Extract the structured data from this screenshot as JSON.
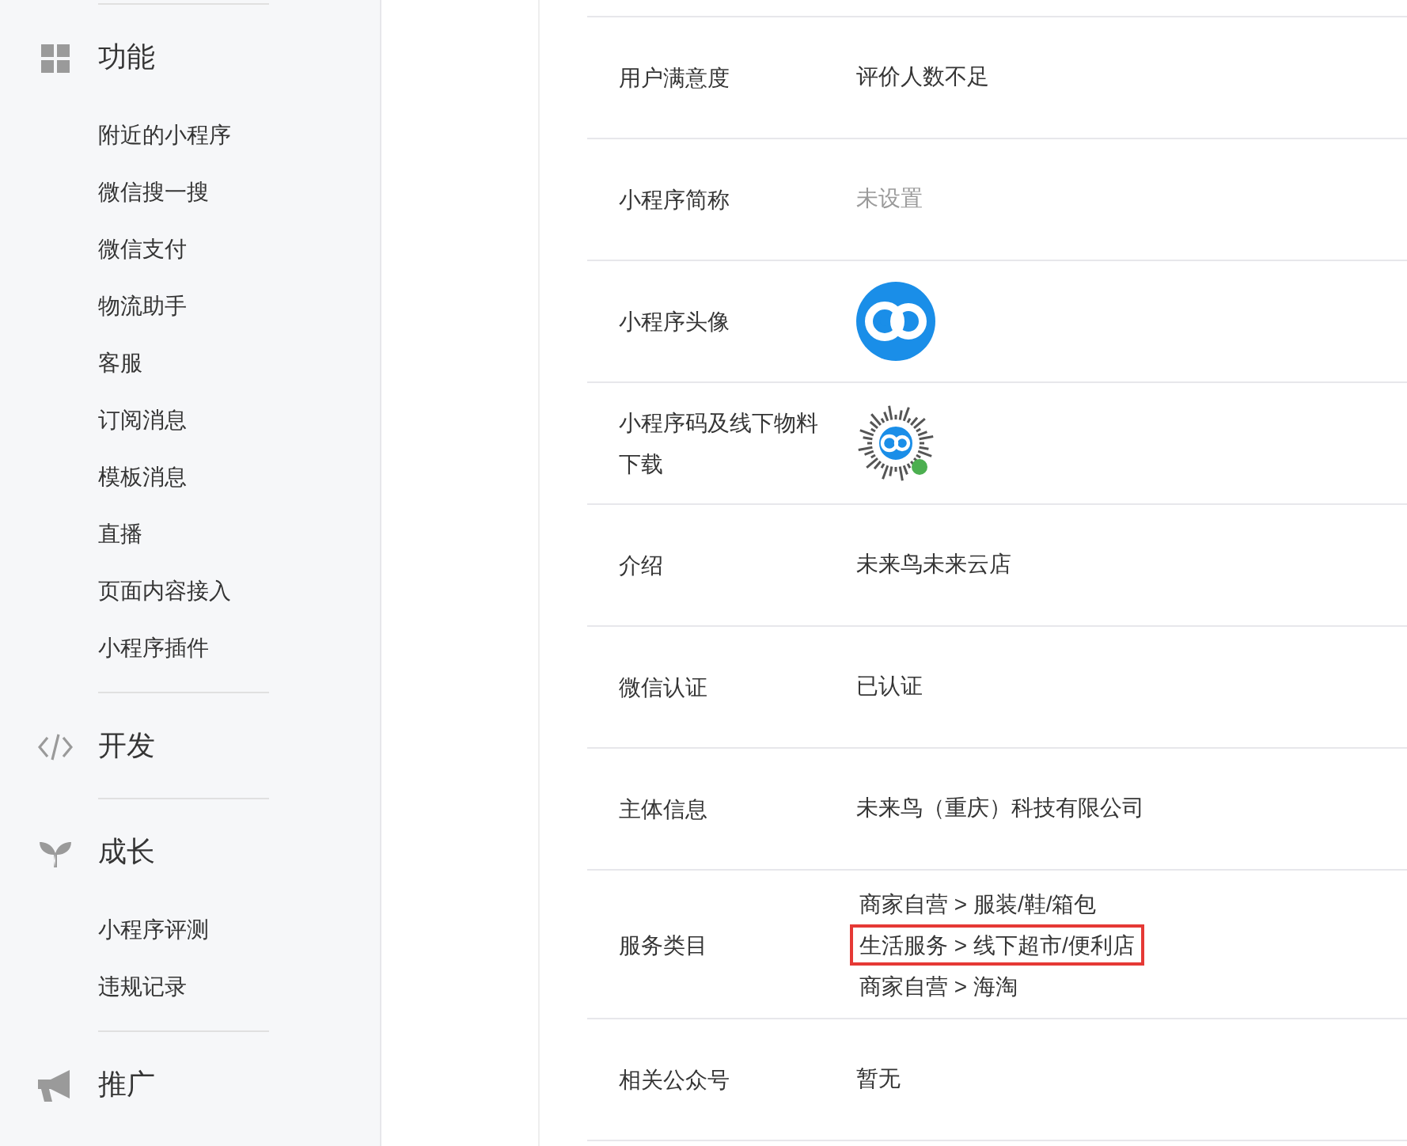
{
  "sidebar": {
    "sections": [
      {
        "title": "功能",
        "items": [
          "附近的小程序",
          "微信搜一搜",
          "微信支付",
          "物流助手",
          "客服",
          "订阅消息",
          "模板消息",
          "直播",
          "页面内容接入",
          "小程序插件"
        ]
      },
      {
        "title": "开发"
      },
      {
        "title": "成长",
        "items": [
          "小程序评测",
          "违规记录"
        ]
      },
      {
        "title": "推广"
      }
    ]
  },
  "rows": [
    {
      "label": "用户满意度",
      "kind": "text",
      "value": "评价人数不足"
    },
    {
      "label": "小程序简称",
      "kind": "muted",
      "value": "未设置"
    },
    {
      "label": "小程序头像",
      "kind": "avatar"
    },
    {
      "label": "小程序码及线下物料下载",
      "kind": "qrcode"
    },
    {
      "label": "介绍",
      "kind": "text",
      "value": "未来鸟未来云店"
    },
    {
      "label": "微信认证",
      "kind": "text",
      "value": "已认证"
    },
    {
      "label": "主体信息",
      "kind": "text",
      "value": "未来鸟（重庆）科技有限公司"
    },
    {
      "label": "服务类目",
      "kind": "list",
      "values": [
        {
          "text": "商家自营 > 服装/鞋/箱包",
          "highlighted": false
        },
        {
          "text": "生活服务 > 线下超市/便利店",
          "highlighted": true
        },
        {
          "text": "商家自营 > 海淘",
          "highlighted": false
        }
      ]
    },
    {
      "label": "相关公众号",
      "kind": "text",
      "value": "暂无"
    }
  ]
}
